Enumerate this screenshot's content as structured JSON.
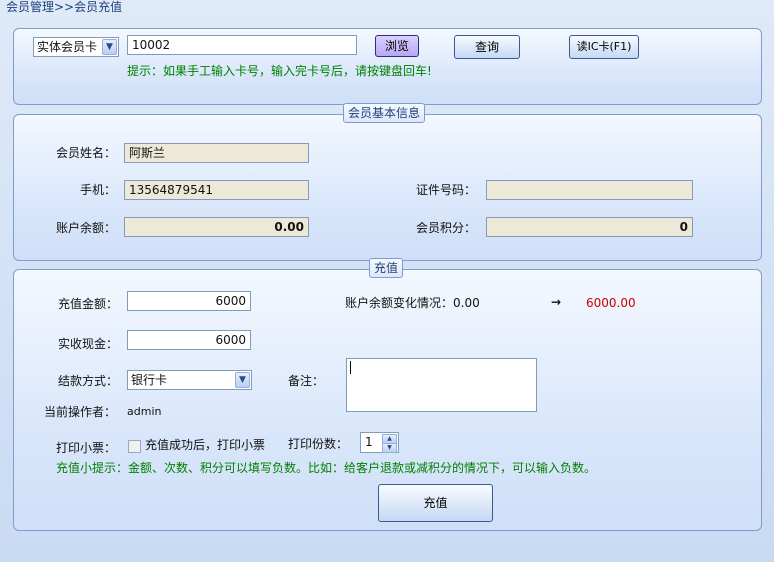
{
  "breadcrumb": "会员管理>>会员充值",
  "search": {
    "card_type": "实体会员卡",
    "card_number": "10002",
    "browse_label": "浏览",
    "query_label": "查询",
    "read_ic_label": "读IC卡(F1)",
    "hint": "提示：如果手工输入卡号，输入完卡号后，请按键盘回车!"
  },
  "member_info": {
    "legend": "会员基本信息",
    "name_label": "会员姓名：",
    "name_value": "阿斯兰",
    "phone_label": "手机：",
    "phone_value": "13564879541",
    "id_label": "证件号码：",
    "id_value": "",
    "balance_label": "账户余额：",
    "balance_value": "0.00",
    "points_label": "会员积分：",
    "points_value": "0"
  },
  "recharge": {
    "legend": "充值",
    "amount_label": "充值金额：",
    "amount_value": "6000",
    "cash_label": "实收现金：",
    "cash_value": "6000",
    "payment_label": "结款方式：",
    "payment_value": "银行卡",
    "remark_label": "备注：",
    "operator_label": "当前操作者：",
    "operator_value": "admin",
    "balance_change_label": "账户余额变化情况：",
    "balance_before": "0.00",
    "arrow": "→",
    "balance_after": "6000.00",
    "print_label": "打印小票：",
    "print_checkbox_label": "充值成功后，打印小票",
    "copies_label": "打印份数：",
    "copies_value": "1",
    "tip": "充值小提示：金额、次数、积分可以填写负数。比如：给客户退款或减积分的情况下，可以输入负数。",
    "submit_label": "充值"
  }
}
